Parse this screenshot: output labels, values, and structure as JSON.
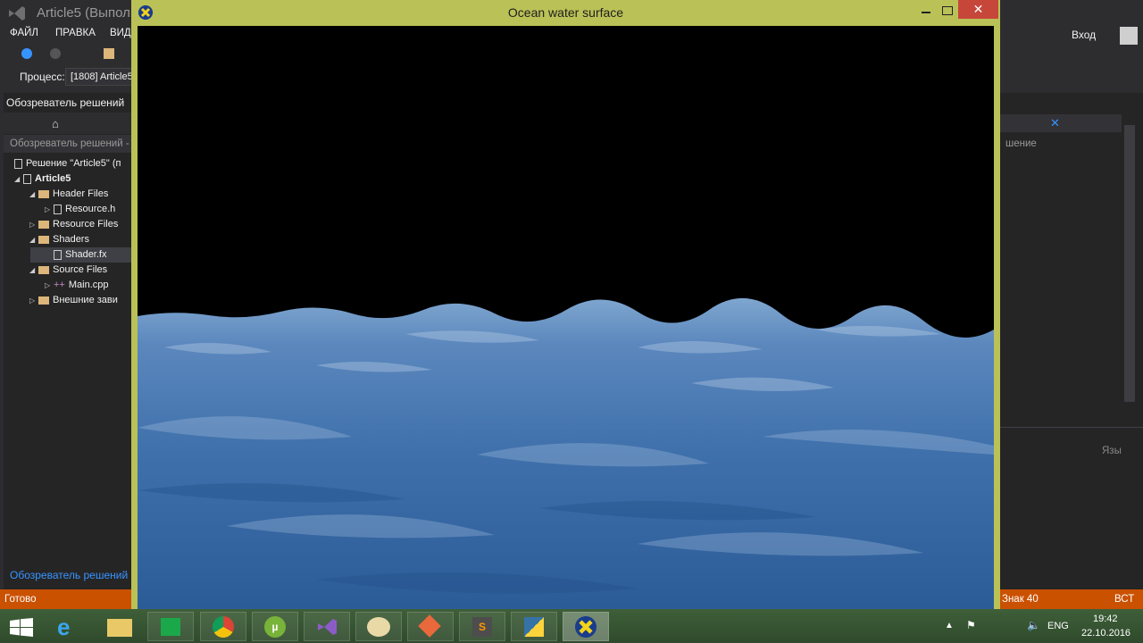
{
  "vs": {
    "title": "Article5 (Выполн",
    "menu": [
      "ФАЙЛ",
      "ПРАВКА",
      "ВИД"
    ],
    "process_label": "Процесс:",
    "process_value": "[1808] Article5",
    "login": "Вход"
  },
  "solution_explorer": {
    "title": "Обозреватель решений",
    "search_placeholder": "Обозреватель решений - п",
    "items": [
      {
        "label": "Решение \"Article5\" (п"
      },
      {
        "label": "Article5"
      },
      {
        "label": "Header Files"
      },
      {
        "label": "Resource.h"
      },
      {
        "label": "Resource Files"
      },
      {
        "label": "Shaders"
      },
      {
        "label": "Shader.fx"
      },
      {
        "label": "Source Files"
      },
      {
        "label": "Main.cpp"
      },
      {
        "label": "Внешние зави"
      }
    ],
    "footer": "Обозреватель решений"
  },
  "status": {
    "ready": "Готово",
    "column": "Знак 40",
    "ins": "ВСТ"
  },
  "right_panel": {
    "label": "шение",
    "lang_label": "Язы"
  },
  "ocean_window": {
    "title": "Ocean water surface"
  },
  "taskbar": {
    "apps": [
      "start-icon",
      "ie-icon",
      "explorer-icon",
      "store-icon",
      "chrome-icon",
      "utorrent-icon",
      "visualstudio-icon",
      "paint-icon",
      "git-icon",
      "sublime-icon",
      "python-icon",
      "directx-app-icon"
    ],
    "lang": "ENG",
    "time": "19:42",
    "date": "22.10.2016"
  },
  "colors": {
    "accent": "#ca5100",
    "window_frame": "#bac156",
    "close": "#c7463a"
  }
}
